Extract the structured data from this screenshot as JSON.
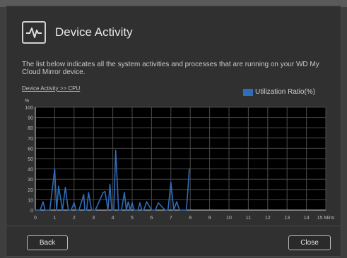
{
  "dialog": {
    "title": "Device Activity",
    "description": "The list below indicates all the system activities and processes that are running on your WD My Cloud Mirror device.",
    "breadcrumb": "Device Activity >> CPU",
    "y_unit": "%",
    "back_label": "Back",
    "close_label": "Close",
    "icon": "activity-pulse-icon"
  },
  "chart_data": {
    "type": "line",
    "legend": {
      "label": "Utilization Ratio(%)",
      "position": "top-right"
    },
    "ylabel": "%",
    "xunit": "Mins",
    "ylim": [
      0,
      100
    ],
    "xlim": [
      0,
      15
    ],
    "grid": true,
    "colors": {
      "line": "#2f6db8",
      "grid": "#4a4a4a",
      "axis": "#d0d0d0"
    },
    "y_ticks": [
      "0",
      "10",
      "20",
      "30",
      "40",
      "50",
      "60",
      "70",
      "80",
      "90",
      "100"
    ],
    "x_ticks": [
      "0",
      "1",
      "2",
      "3",
      "4",
      "5",
      "6",
      "7",
      "8",
      "9",
      "10",
      "11",
      "12",
      "13",
      "14",
      "15 Mins"
    ],
    "x": [
      0,
      0.25,
      0.4,
      0.5,
      0.75,
      1.0,
      1.1,
      1.2,
      1.4,
      1.55,
      1.7,
      1.85,
      2.0,
      2.1,
      2.25,
      2.5,
      2.55,
      2.65,
      2.75,
      2.9,
      3.0,
      3.1,
      3.5,
      3.6,
      3.75,
      3.85,
      3.95,
      4.05,
      4.15,
      4.3,
      4.45,
      4.6,
      4.7,
      4.8,
      4.9,
      5.0,
      5.1,
      5.3,
      5.4,
      5.5,
      5.6,
      5.75,
      6.0,
      6.1,
      6.2,
      6.35,
      6.7,
      6.85,
      7.0,
      7.15,
      7.3,
      7.45,
      7.65,
      7.8,
      7.88,
      7.95
    ],
    "y": [
      0,
      0,
      8,
      0,
      0,
      40,
      0,
      23,
      0,
      22,
      0,
      0,
      7,
      0,
      0,
      15,
      0,
      0,
      17,
      0,
      0,
      0,
      17,
      18,
      0,
      25,
      0,
      0,
      58,
      0,
      0,
      17,
      0,
      8,
      0,
      7,
      0,
      0,
      7,
      0,
      0,
      8,
      0,
      0,
      0,
      7,
      0,
      0,
      27,
      0,
      8,
      0,
      0,
      0,
      20,
      40
    ]
  }
}
